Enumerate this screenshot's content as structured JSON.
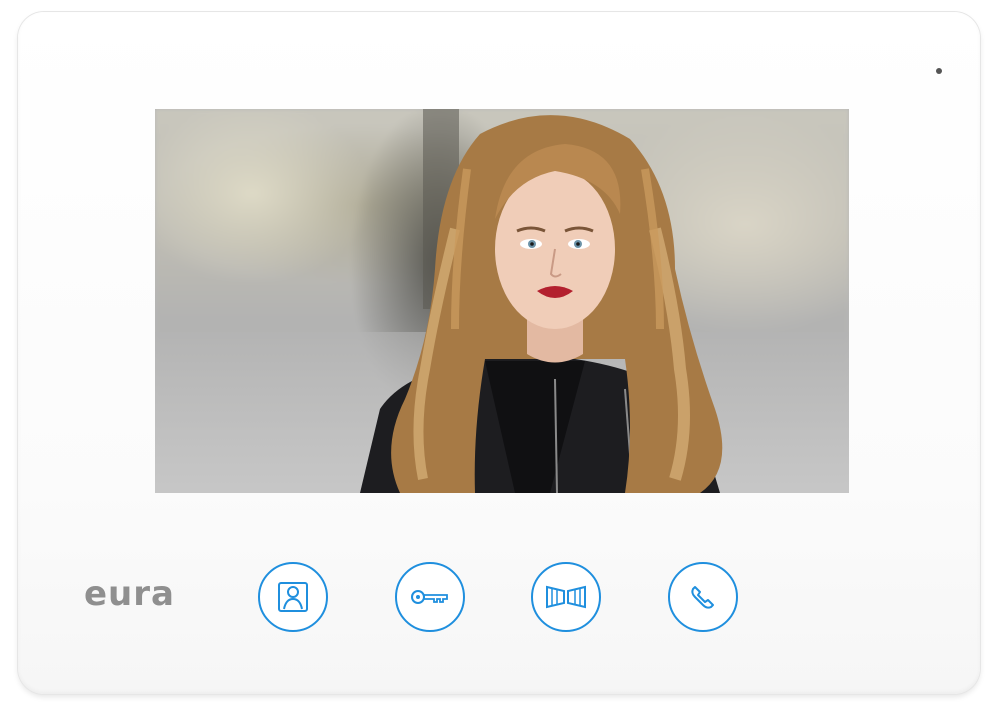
{
  "device": {
    "brand": "eura"
  },
  "screen": {
    "content": "camera-feed-visitor-portrait"
  },
  "buttons": [
    {
      "name": "monitor",
      "icon": "person-monitor-icon"
    },
    {
      "name": "unlock",
      "icon": "key-icon"
    },
    {
      "name": "gate",
      "icon": "gate-icon"
    },
    {
      "name": "call",
      "icon": "handset-icon"
    }
  ],
  "colors": {
    "accent": "#1f8fde",
    "brand": "#8f8f8f",
    "body": "#ffffff"
  }
}
